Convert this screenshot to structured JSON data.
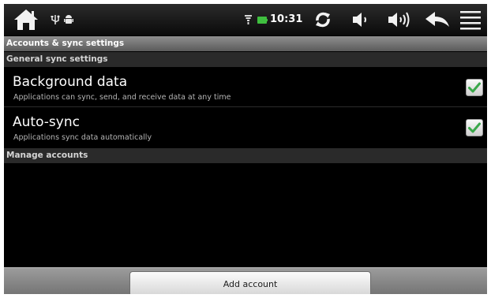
{
  "status_bar": {
    "time": "10:31",
    "icons": [
      "home-icon",
      "usb-icon",
      "android-debug-icon",
      "signal-icon",
      "battery-icon",
      "sync-icon",
      "volume-down-icon",
      "volume-up-icon",
      "back-icon",
      "menu-icon"
    ]
  },
  "title": "Accounts & sync settings",
  "sections": {
    "general": "General sync settings",
    "manage": "Manage accounts"
  },
  "settings": [
    {
      "title": "Background data",
      "summary": "Applications can sync, send, and receive data at any time",
      "checked": true
    },
    {
      "title": "Auto-sync",
      "summary": "Applications sync data automatically",
      "checked": true
    }
  ],
  "add_account_label": "Add account",
  "colors": {
    "check": "#3aa84a",
    "background": "#000000",
    "title_bar": "#7a7a7a"
  }
}
